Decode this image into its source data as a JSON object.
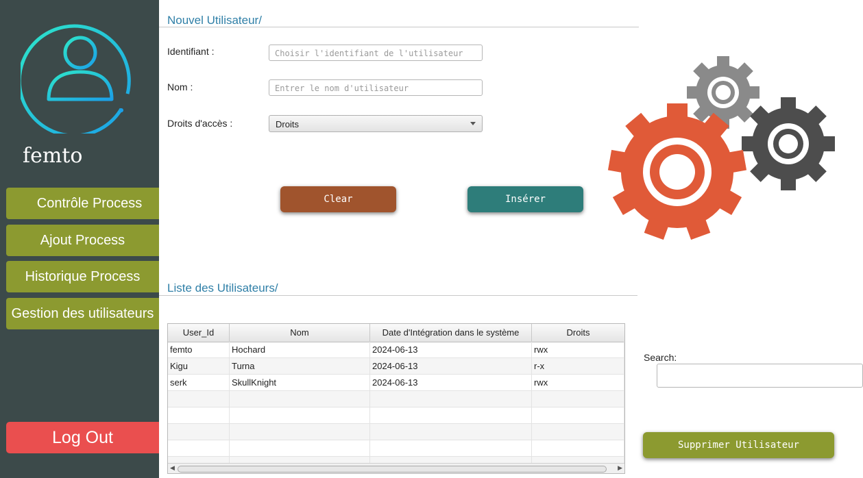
{
  "sidebar": {
    "username": "femto",
    "nav": [
      {
        "label": "Contrôle Process"
      },
      {
        "label": "Ajout Process"
      },
      {
        "label": "Historique Process"
      },
      {
        "label": "Gestion des utilisateurs"
      }
    ],
    "logout_label": "Log Out"
  },
  "new_user": {
    "title": "Nouvel Utilisateur/",
    "id_label": "Identifiant :",
    "id_placeholder": "Choisir l'identifiant de l'utilisateur",
    "name_label": "Nom :",
    "name_placeholder": "Entrer le nom d'utilisateur",
    "rights_label": "Droits d'accès :",
    "rights_selected": "Droits",
    "clear_label": "Clear",
    "insert_label": "Insérer"
  },
  "user_list": {
    "title": "Liste des Utilisateurs/",
    "columns": [
      "User_Id",
      "Nom",
      "Date d'Intégration dans le système",
      "Droits"
    ],
    "rows": [
      [
        "femto",
        "Hochard",
        "2024-06-13",
        "rwx"
      ],
      [
        "Kigu",
        "Turna",
        "2024-06-13",
        "r-x"
      ],
      [
        "serk",
        "SkullKnight",
        "2024-06-13",
        "rwx"
      ]
    ]
  },
  "search": {
    "label": "Search:",
    "value": ""
  },
  "delete_label": "Supprimer Utilisateur",
  "colors": {
    "sidebar_bg": "#3c4a4a",
    "nav_green": "#8c9a30",
    "logout_red": "#ea4f4f",
    "clear_brown": "#a0542d",
    "insert_teal": "#2e7d7a",
    "title_blue": "#2f7fa7",
    "gear_orange": "#e05a38",
    "gear_gray": "#8a8a8a",
    "gear_dark": "#4d4d4d"
  },
  "icons": [
    "user-avatar-icon",
    "gears-icon",
    "dropdown-caret-icon",
    "scroll-left-icon",
    "scroll-right-icon"
  ]
}
